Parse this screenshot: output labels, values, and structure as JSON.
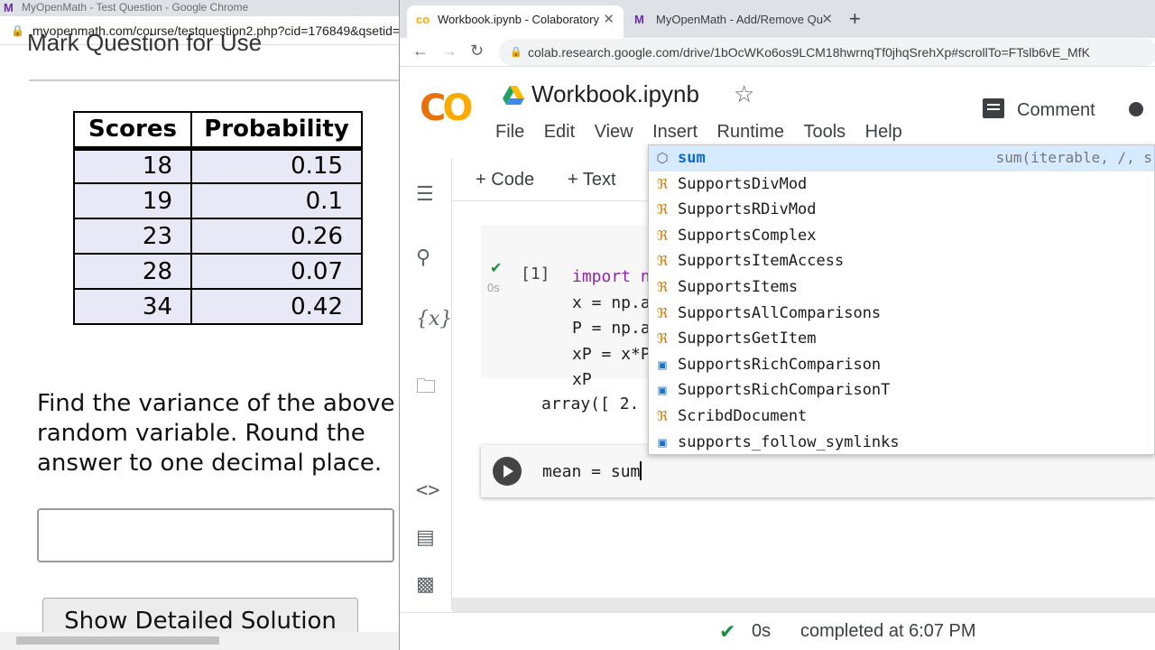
{
  "left_window": {
    "title": "MyOpenMath - Test Question - Google Chrome",
    "url": "myopenmath.com/course/testquestion2.php?cid=176849&qsetid=",
    "mark_question_label": "Mark Question for Use",
    "table": {
      "headers": [
        "Scores",
        "Probability"
      ],
      "rows": [
        [
          "18",
          "0.15"
        ],
        [
          "19",
          "0.1"
        ],
        [
          "23",
          "0.26"
        ],
        [
          "28",
          "0.07"
        ],
        [
          "34",
          "0.42"
        ]
      ]
    },
    "question": "Find the variance of the above random variable. Round the answer to one decimal place.",
    "answer_value": "",
    "detail_button_label": "Show Detailed Solution"
  },
  "right_window": {
    "tabs": [
      {
        "label": "Workbook.ipynb - Colaboratory",
        "icon": "colab-icon"
      },
      {
        "label": "MyOpenMath - Add/Remove Qu",
        "icon": "myopenmath-icon"
      }
    ],
    "url": "colab.research.google.com/drive/1bOcWKo6os9LCM18hwrnqTf0jhqSrehXp#scrollTo=FTslb6vE_MfK",
    "notebook_title": "Workbook.ipynb",
    "menus": [
      "File",
      "Edit",
      "View",
      "Insert",
      "Runtime",
      "Tools",
      "Help"
    ],
    "comment_label": "Comment",
    "toolbar": {
      "code_label": "Code",
      "text_label": "Text"
    },
    "cell1": {
      "exec_count": "[1]",
      "time": "0s",
      "lines": [
        "import num",
        "x = np.arr",
        "P = np.arr",
        "xP = x*P",
        "xP"
      ],
      "output": "array([ 2."
    },
    "cell2": {
      "code": "mean = sum"
    },
    "autocomplete": {
      "detail": "sum(iterable, /, s",
      "items": [
        {
          "label": "sum",
          "kind": "function"
        },
        {
          "label": "SupportsDivMod",
          "kind": "class"
        },
        {
          "label": "SupportsRDivMod",
          "kind": "class"
        },
        {
          "label": "SupportsComplex",
          "kind": "class"
        },
        {
          "label": "SupportsItemAccess",
          "kind": "class"
        },
        {
          "label": "SupportsItems",
          "kind": "class"
        },
        {
          "label": "SupportsAllComparisons",
          "kind": "class"
        },
        {
          "label": "SupportsGetItem",
          "kind": "class"
        },
        {
          "label": "SupportsRichComparison",
          "kind": "module"
        },
        {
          "label": "SupportsRichComparisonT",
          "kind": "module"
        },
        {
          "label": "ScribdDocument",
          "kind": "class"
        },
        {
          "label": "supports_follow_symlinks",
          "kind": "module"
        }
      ]
    },
    "status": {
      "time": "0s",
      "text": "completed at 6:07 PM"
    }
  },
  "colors": {
    "table_cell_bg": "#e8e8f6",
    "selected_row": "#d6ebff",
    "match_highlight": "#0b6bd3",
    "success_green": "#1e8e3e",
    "keyword_purple": "#8e24aa"
  }
}
